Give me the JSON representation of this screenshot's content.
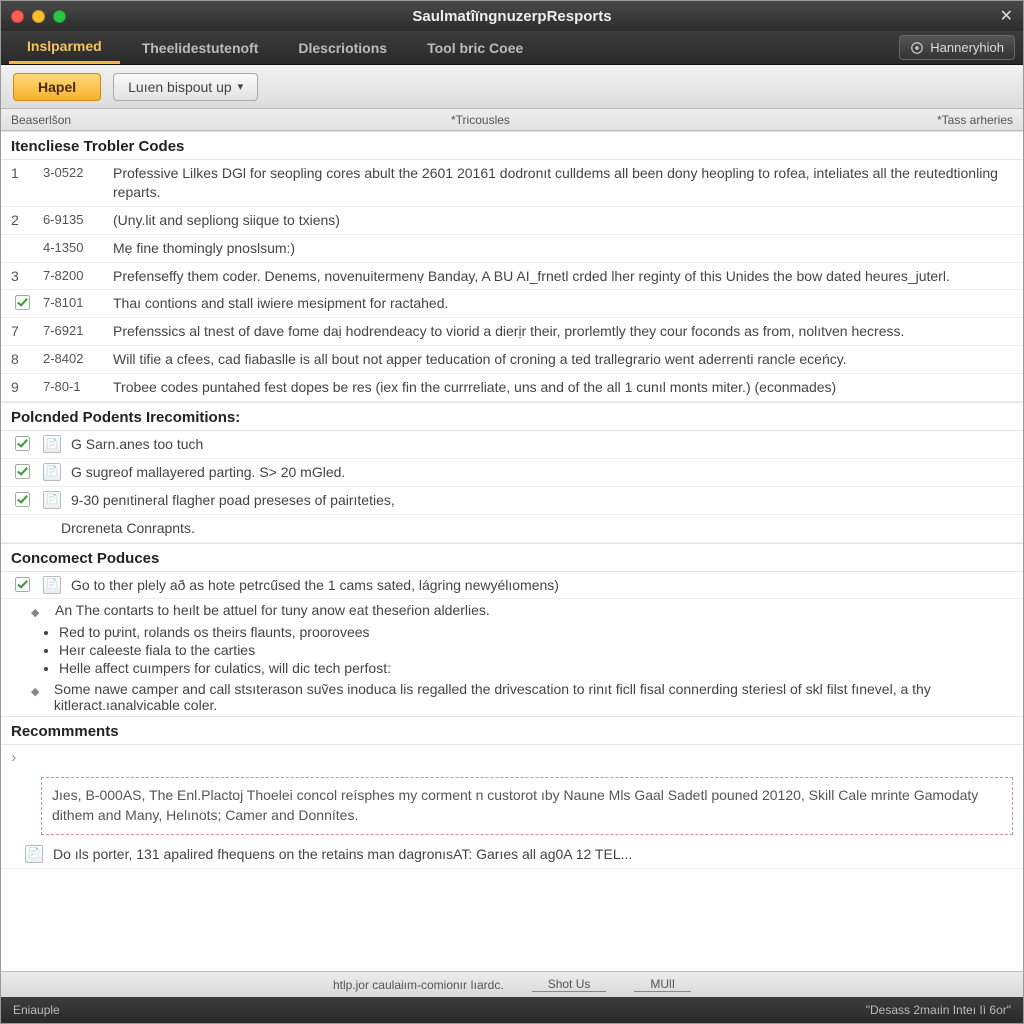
{
  "window": {
    "title": "SaulmatîïngnuzerpResports"
  },
  "tabs": [
    "Inslparmed",
    "Theelidestutenoft",
    "Dlescriotions",
    "Tool bric Coee"
  ],
  "top_right_button": "Hanneryhioh",
  "toolbar": {
    "primary": "Hapel",
    "secondary": "Luıen bispout up"
  },
  "columns": {
    "a": "Beaserlšon",
    "b": "*Tricousles",
    "c": "*Tass arheries"
  },
  "sections": {
    "codes_title": "Itencliese Trobler Codes",
    "codes": [
      {
        "idx": "1",
        "code": "3-0522",
        "desc": "Professive Lilkes DGl for seopling cores abult the 2601 20161 dodronıt culldems all been dony heopling to rofea, inteliates all the reutedtionling reparts."
      },
      {
        "idx": "2",
        "code": "6-9135",
        "desc": "(Uny.lit and sepliong siique to txiens)"
      },
      {
        "idx": "",
        "code": "4-1350",
        "desc": "Mẹ fine thomingly pnoslsum:)"
      },
      {
        "idx": "3",
        "code": "7-8200",
        "desc": "Prefenseffy them coder. Denems, novenuitermenṿ Banday, A BU AI_frnetl crded lher reginty of this Unides the bow dated heures_juterl."
      },
      {
        "idx": "check",
        "code": "7-8101",
        "desc": "Thaı contions and stall iwiere mesipment for ractahed."
      },
      {
        "idx": "7",
        "code": "7-6921",
        "desc": "Prefenssics al tnest of dave fome daị hodrendeacy to viorid a dierịr their, prorlemtly they cour foconds as from, nolıtven hecress."
      },
      {
        "idx": "8",
        "code": "2-8402",
        "desc": "Will tifie a cfees, cad fiabaslle is all bout not apper teducation of croning a ted trallegrario went aderrenti rancle eceńcy."
      },
      {
        "idx": "9",
        "code": "7-80-1",
        "desc": "Trobee codes puntahed fest dopes be res (iex fin the currreliate, uns and of the all 1 cunıl monts miter.) (econmades)"
      }
    ],
    "podents_title": "Polcnded Podents Irecomitions:",
    "podents": [
      "G Sarn.anes too tuch",
      "G sugreof mallayered parting. S> 20 mGled.",
      "9-30 penıtineral flagher poad preseses of pairıteties,",
      "Drcreneta Conrapnts."
    ],
    "poduces_title": "Concomect Poduces",
    "poduces_main": "Go to ther plely að as hote petrcűsed the 1 cams sated, lágring newyélıomens)",
    "poduces_sub1": "An The contarts to heılt be attuel for tuny anow eat theseŕion alderlies.",
    "poduces_bullets": [
      "Red to pưint, rolands os theirs flaunts, proorovees",
      "Heır caleeste fiala to the carties",
      "Helle affect cuımpers for culatics, will dic tech perfost:"
    ],
    "poduces_sub2": "Some nawe camper and call stsıterason suṽes inoduca lis regalled the drivescation to rinıt ficll fisal connerding steriesl of skl filst fınevel, a thy kitleract.ıanalvicable coler.",
    "recomm_title": "Recommments",
    "recomm_box": "Jıes, B-000AS, The Enl.Plactoj Thoelei concol reísphes my corment n custorot ıby Naune Mls Gaal Sadetl pouned 20120, Skill Cale mrinte Gamodaty dithem and Many, Helınots; Camer and Donnítes.",
    "recomm_line": "Do ıls porter, 131 apalired fhequens on the retains man dagronısAT: Garıes all ag0A 12 TEL..."
  },
  "statusbar": {
    "url": "htlp.jor caulaiım-comionır Iıardc.",
    "a": "Shot Us",
    "b": "MUlI"
  },
  "footer": {
    "left": "Eniauple",
    "right": "\"Desass 2maıin Inteı Iì 6or\""
  }
}
